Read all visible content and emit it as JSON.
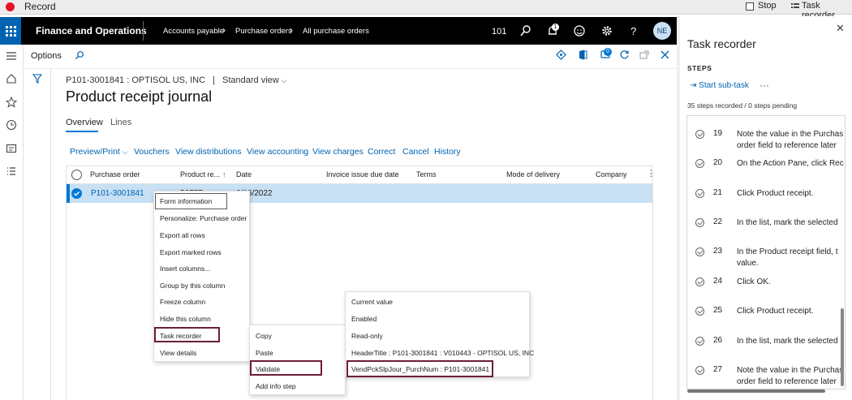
{
  "record_bar": {
    "title": "Record",
    "stop": "Stop",
    "task_recorder": "Task recorder"
  },
  "app": {
    "name": "Finance and Operations",
    "breadcrumb": [
      "Accounts payable",
      "Purchase orders",
      "All purchase orders"
    ],
    "company": "101",
    "notification_count": "1",
    "avatar": "NE"
  },
  "options_bar": {
    "label": "Options",
    "badge": "0"
  },
  "page": {
    "subtitle": "P101-3001841 : OPTISOL US, INC",
    "separator": "|",
    "view": "Standard view",
    "title": "Product receipt journal",
    "tabs": [
      "Overview",
      "Lines"
    ],
    "actions": [
      "Preview/Print",
      "Vouchers",
      "View distributions",
      "View accounting",
      "View charges",
      "Correct",
      "Cancel",
      "History"
    ]
  },
  "grid": {
    "columns": [
      "Purchase order",
      "Product re...",
      "Date",
      "Invoice issue due date",
      "Terms",
      "Mode of delivery",
      "Company"
    ],
    "rows": [
      {
        "purchase_order": "P101-3001841",
        "product_receipt": "56777",
        "date": "6/16/2022"
      }
    ]
  },
  "context_menu": [
    "Form information",
    "Personalize: Purchase order",
    "Export all rows",
    "Export marked rows",
    "Insert columns...",
    "Group by this column",
    "Freeze column",
    "Hide this column",
    "Task recorder",
    "View details"
  ],
  "submenu_1": [
    "Copy",
    "Paste",
    "Validate",
    "Add info step"
  ],
  "submenu_2": [
    "Current value",
    "Enabled",
    "Read-only",
    "HeaderTitle : P101-3001841 : V010443 - OPTISOL US, INC",
    "VendPckSlpJour_PurchNum : P101-3001841"
  ],
  "task_recorder": {
    "title": "Task recorder",
    "steps_label": "STEPS",
    "start_subtask": "Start sub-task",
    "more": "···",
    "count": "35 steps recorded / 0 steps pending",
    "steps": [
      {
        "num": "19",
        "line1": "Note the value in the Purchas",
        "line2": "order field to reference later"
      },
      {
        "num": "20",
        "line1": "On the Action Pane, click Rec",
        "line2": ""
      },
      {
        "num": "21",
        "line1": "Click Product receipt.",
        "line2": ""
      },
      {
        "num": "22",
        "line1": "In the list, mark the selected",
        "line2": ""
      },
      {
        "num": "23",
        "line1": "In the Product receipt field, t",
        "line2": "value."
      },
      {
        "num": "24",
        "line1": "Click OK.",
        "line2": ""
      },
      {
        "num": "25",
        "line1": "Click Product receipt.",
        "line2": ""
      },
      {
        "num": "26",
        "line1": "In the list, mark the selected",
        "line2": ""
      },
      {
        "num": "27",
        "line1": "Note the value in the Purchas",
        "line2": "order field to reference later"
      }
    ]
  },
  "colors": {
    "accent": "#0078d4",
    "highlight": "#6b1d3d",
    "selected_row": "#c7e0f4",
    "record": "#e81123"
  }
}
